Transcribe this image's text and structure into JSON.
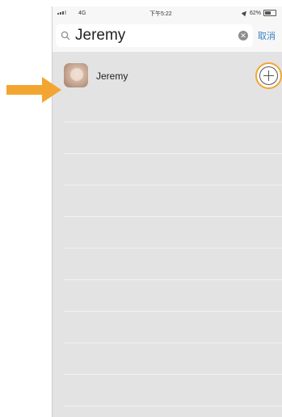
{
  "status_bar": {
    "network": "4G",
    "time": "下午5:22",
    "battery": "62%",
    "battery_level": 0.62
  },
  "search": {
    "query": "Jeremy",
    "cancel_label": "取消"
  },
  "results": [
    {
      "name": "Jeremy"
    }
  ],
  "colors": {
    "highlight": "#f3a531",
    "link": "#3b82c4",
    "list_background": "#e3e3e3"
  },
  "icons": {
    "search": "search-icon",
    "clear": "clear-icon",
    "add": "add-contact-icon",
    "pointer": "arrow-right-icon"
  }
}
